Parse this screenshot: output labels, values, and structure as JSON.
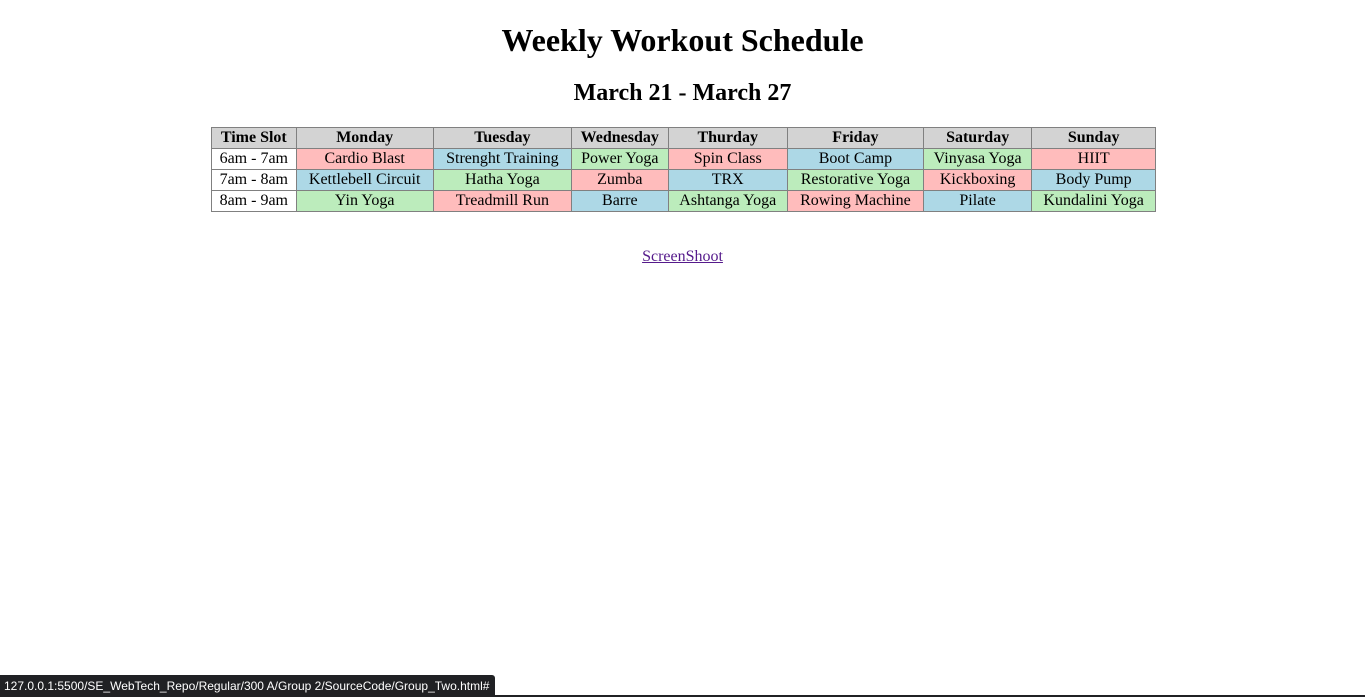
{
  "page": {
    "title": "Weekly Workout Schedule",
    "date_range": "March 21 - March 27"
  },
  "table": {
    "headers": [
      "Time Slot",
      "Monday",
      "Tuesday",
      "Wednesday",
      "Thurday",
      "Friday",
      "Saturday",
      "Sunday"
    ],
    "rows": [
      {
        "time": "6am - 7am",
        "cells": [
          "Cardio Blast",
          "Strenght Training",
          "Power Yoga",
          "Spin Class",
          "Boot Camp",
          "Vinyasa Yoga",
          "HIIT"
        ],
        "colors": [
          "red",
          "blue",
          "green",
          "red",
          "blue",
          "green",
          "red"
        ]
      },
      {
        "time": "7am - 8am",
        "cells": [
          "Kettlebell Circuit",
          "Hatha Yoga",
          "Zumba",
          "TRX",
          "Restorative Yoga",
          "Kickboxing",
          "Body Pump"
        ],
        "colors": [
          "blue",
          "green",
          "red",
          "blue",
          "green",
          "red",
          "blue"
        ]
      },
      {
        "time": "8am - 9am",
        "cells": [
          "Yin Yoga",
          "Treadmill Run",
          "Barre",
          "Ashtanga Yoga",
          "Rowing Machine",
          "Pilate",
          "Kundalini Yoga"
        ],
        "colors": [
          "green",
          "red",
          "blue",
          "green",
          "red",
          "blue",
          "green"
        ]
      }
    ]
  },
  "link": {
    "label": "ScreenShoot"
  },
  "status_bar": {
    "url": "127.0.0.1:5500/SE_WebTech_Repo/Regular/300 A/Group 2/SourceCode/Group_Two.html#"
  },
  "colors": {
    "red": "#ffbcbc",
    "blue": "#add8e6",
    "green": "#bcecbc",
    "header": "#d3d3d3",
    "link": "#551a8b",
    "status_bar_bg": "#202124"
  }
}
